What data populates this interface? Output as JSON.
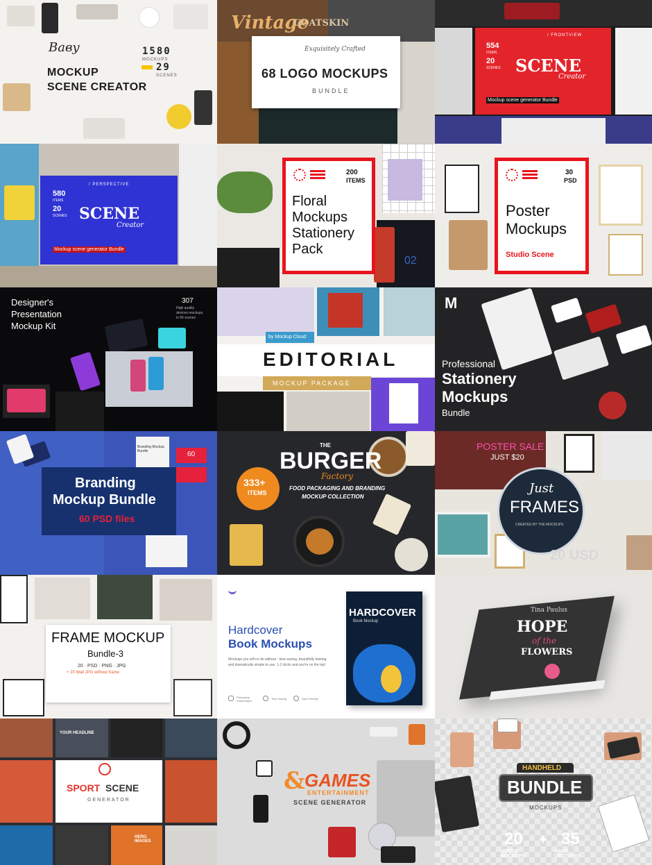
{
  "tiles": {
    "t1": {
      "brand": "Ваву",
      "count1": "1580",
      "unit1": "MOCKUPS",
      "count2": "29",
      "unit2": "SCENES",
      "title1": "MOCKUP",
      "title2": "SCENE CREATOR"
    },
    "t2": {
      "top_word": "Vintage",
      "badge_top": "GOATSKIN",
      "crafted": "Exquisitely Crafted",
      "title": "68 LOGO MOCKUPS",
      "sub": "BUNDLE"
    },
    "t3": {
      "view": "/ FRONTVIEW",
      "count1": "554",
      "unit1": "ITEMS",
      "count2": "20",
      "unit2": "SCENES",
      "title": "SCENE",
      "script": "Creator",
      "desc": "Mockup scene generator Bundle"
    },
    "t4": {
      "view": "/ PERSPECTIVE",
      "count1": "580",
      "unit1": "ITEMS",
      "count2": "20",
      "unit2": "SCENES",
      "title": "SCENE",
      "script": "Creator",
      "desc": "Mockup scene generator Bundle"
    },
    "t5": {
      "count": "200",
      "unit": "ITEMS",
      "line1": "Floral",
      "line2": "Mockups",
      "line3": "Stationery",
      "line4": "Pack",
      "number": "02"
    },
    "t6": {
      "count": "30",
      "unit": "PSD",
      "line1": "Poster",
      "line2": "Mockups",
      "sub": "Studio Scene"
    },
    "t7": {
      "line1": "Designer's",
      "line2": "Presentation",
      "line3": "Mockup Kit",
      "count": "307",
      "desc1": "High quality",
      "desc2": "devices mockups",
      "desc3": "in 56 scenes"
    },
    "t8": {
      "by": "by Mockup Cloud",
      "title": "EDITORIAL",
      "sub": "MOCKUP PACKAGE"
    },
    "t9": {
      "logo": "M",
      "line1": "Professional",
      "line2": "Stationery",
      "line3": "Mockups",
      "line4": "Bundle"
    },
    "t10": {
      "title1": "Branding",
      "title2": "Mockup Bundle",
      "sub": "60 PSD files",
      "card": "Branding Mockup Bundle",
      "num": "60"
    },
    "t11": {
      "the": "THE",
      "title": "BURGER",
      "script": "Factory",
      "count": "333+",
      "unit": "ITEMS",
      "desc1": "FOOD PACKAGING AND BRANDING",
      "desc2": "MOCKUP COLLECTION"
    },
    "t12": {
      "sale": "POSTER SALE",
      "price": "JUST $20",
      "just": "Just",
      "title": "FRAMES",
      "sub": "CREATED BY THE MOCKUPS",
      "big": "20 USD"
    },
    "t13": {
      "title": "FRAME MOCKUP",
      "bundle": "Bundle-3",
      "formats": "20 · PSD · PNG · JPG",
      "extra": "+ 20 Wall JPG without frame"
    },
    "t14": {
      "line1": "Hardcover",
      "line2": "Book Mockups",
      "desc": "Mockups you will no do without - time-saving, beautifully looking and dramatically simple to use. 1-2 clicks and you're on the top!",
      "f1": "Photoshop SmartObject",
      "f2": "Time Saving",
      "f3": "User Friendly",
      "book_title": "HARDCOVER",
      "book_sub": "Book Mockup"
    },
    "t15": {
      "author": "Tina Paulus",
      "hope": "HOPE",
      "of_the": "of the",
      "flowers": "FLOWERS"
    },
    "t16": {
      "sport": "SPORT",
      "scene": "SCENE",
      "gen": "GENERATOR",
      "headline": "YOUR HEADLINE",
      "hero": "HERO IMAGES"
    },
    "t17": {
      "amp": "&",
      "games": "GAMES",
      "ent": "ENTERTAINMENT",
      "gen": "SCENE GENERATOR"
    },
    "t18": {
      "handheld": "HANDHELD",
      "bundle": "BUNDLE",
      "mockups": "MOCKUPS",
      "n1": "20",
      "l1": "UNIQUE MOCKUPS",
      "plus": "+",
      "n2": "35",
      "l2": "HAND GESTURES"
    }
  }
}
